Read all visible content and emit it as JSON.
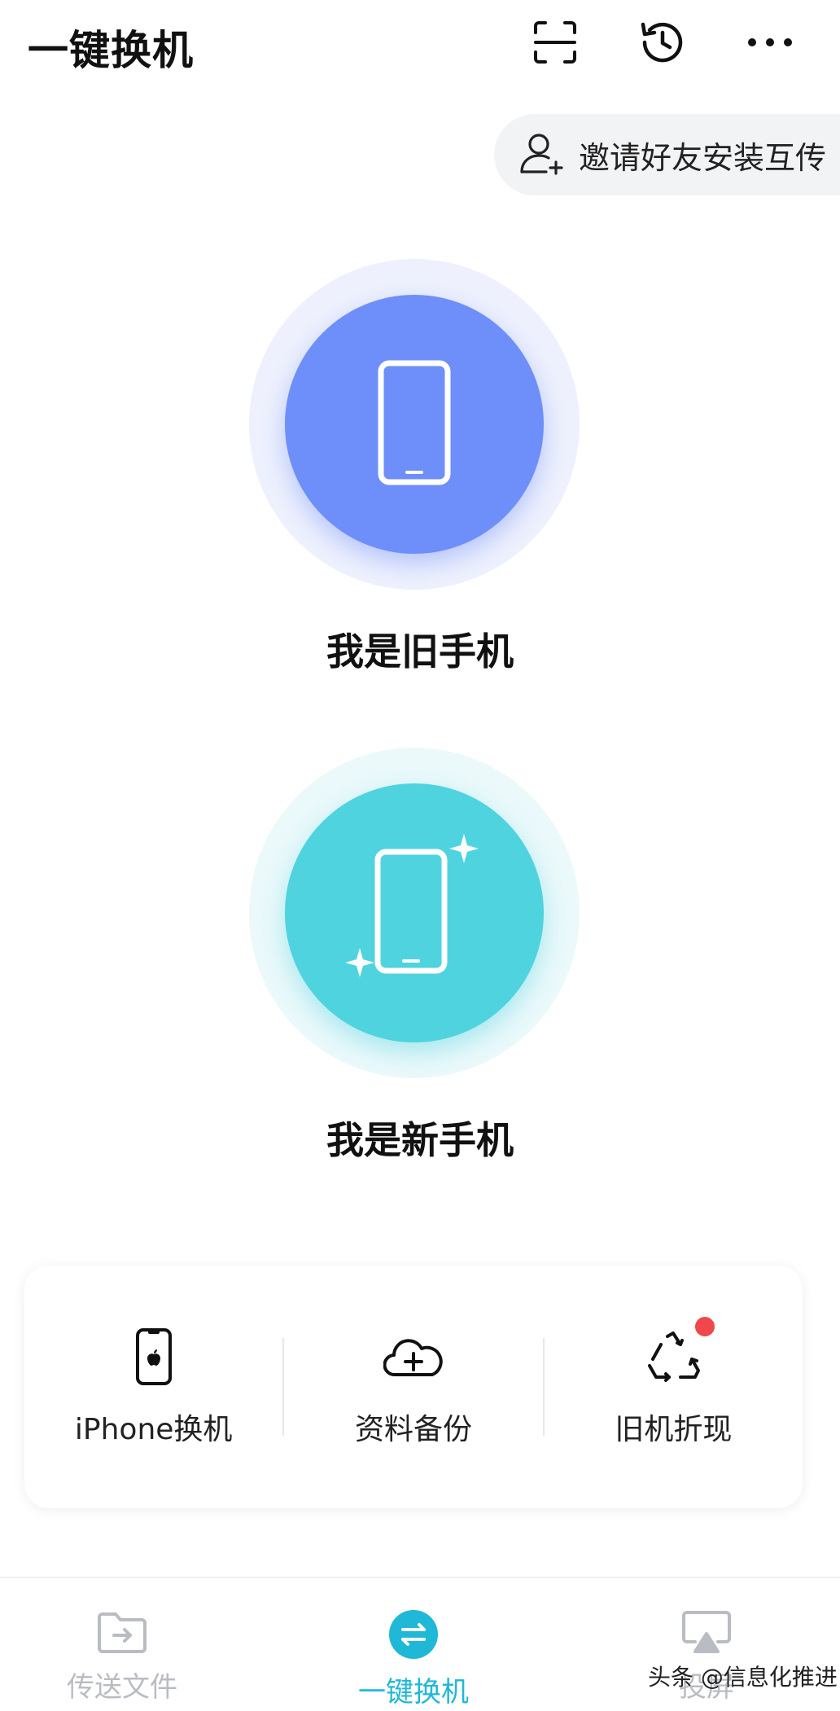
{
  "header": {
    "title": "一键换机",
    "icons": [
      "scan-icon",
      "history-icon",
      "more-icon"
    ]
  },
  "invite": {
    "label": "邀请好友安装互传"
  },
  "roles": {
    "old_label": "我是旧手机",
    "new_label": "我是新手机",
    "old_color": "#6e8ff9",
    "new_color": "#4fd3df"
  },
  "tools": [
    {
      "label": "iPhone换机",
      "icon": "iphone-icon"
    },
    {
      "label": "资料备份",
      "icon": "cloud-upload-icon"
    },
    {
      "label": "旧机折现",
      "icon": "recycle-icon",
      "badge": true
    }
  ],
  "bottom_nav": {
    "items": [
      {
        "label": "传送文件",
        "icon": "folder-transfer-icon",
        "active": false
      },
      {
        "label": "一键换机",
        "icon": "switch-icon",
        "active": true
      },
      {
        "label": "投屏",
        "icon": "screen-cast-icon",
        "active": false
      }
    ],
    "active_color": "#1fb8d7",
    "inactive_color": "#b9bcc2"
  },
  "watermark": "头条 @信息化推进"
}
